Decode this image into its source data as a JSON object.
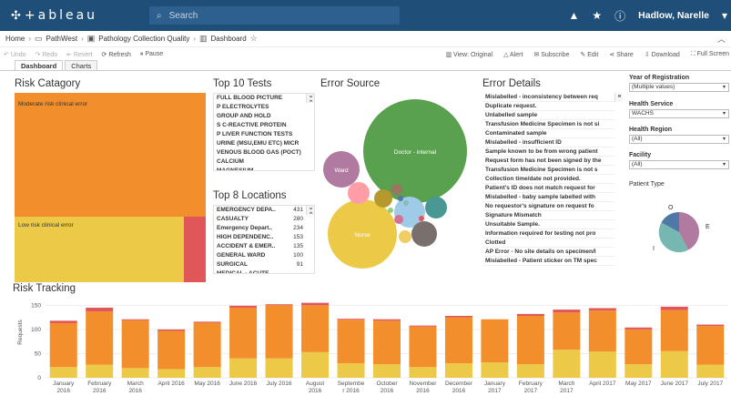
{
  "app": {
    "logo_text": "+ableau",
    "search_placeholder": "Search",
    "user_name": "Hadlow, Narelle"
  },
  "breadcrumb": {
    "items": [
      "Home",
      "PathWest",
      "Pathology Collection Quality",
      "Dashboard"
    ]
  },
  "toolbar": {
    "undo": "Undo",
    "redo": "Redo",
    "revert": "Revert",
    "refresh": "Refresh",
    "pause": "Pause",
    "view": "View: Original",
    "alert": "Alert",
    "subscribe": "Subscribe",
    "edit": "Edit",
    "share": "Share",
    "download": "Download",
    "fullscreen": "Full Screen"
  },
  "tabs": [
    "Dashboard",
    "Charts"
  ],
  "risk_category": {
    "title": "Risk Catagory",
    "blocks": [
      {
        "label": "Moderate risk clinical error",
        "color": "#f28e2b"
      },
      {
        "label": "Low risk clinical error",
        "color": "#edc948"
      },
      {
        "label": "",
        "color": "#e15759"
      }
    ]
  },
  "top_tests": {
    "title": "Top 10 Tests",
    "items": [
      "FULL BLOOD PICTURE",
      "P ELECTROLYTES",
      "GROUP AND HOLD",
      "S C-REACTIVE PROTEIN",
      "P LIVER FUNCTION TESTS",
      "URINE (MSU,EMU ETC) MICR",
      "VENOUS BLOOD GAS (POCT)",
      "CALCIUM",
      "MAGNESIUM"
    ]
  },
  "top_locations": {
    "title": "Top 8 Locations",
    "items": [
      {
        "name": "EMERGENCY DEPA..",
        "count": "431"
      },
      {
        "name": "CASUALTY",
        "count": "280"
      },
      {
        "name": "Emergency Depart..",
        "count": "234"
      },
      {
        "name": "HIGH DEPENDENC..",
        "count": "153"
      },
      {
        "name": "ACCIDENT & EMER..",
        "count": "135"
      },
      {
        "name": "GENERAL WARD",
        "count": "100"
      },
      {
        "name": "SURGICAL",
        "count": "91"
      },
      {
        "name": "MEDICAL - ACUTE",
        "count": ""
      }
    ]
  },
  "error_source": {
    "title": "Error Source",
    "bubble_labels": {
      "doctor": "Doctor - internal",
      "nurse": "Nurse",
      "ward": "Ward"
    }
  },
  "error_details": {
    "title": "Error Details",
    "items": [
      "Mislabelled - inconsistency between req",
      "Duplicate request.",
      "Unlabelled sample",
      "Transfusion Medicine Specimen is not si",
      "Contaminated sample",
      "Mislabelled - insufficient ID",
      "Sample known to be from wrong patient",
      "Request form has not been signed by the",
      "Transfusion Medicine Specimen is not s",
      "Collection time/date not provided.",
      "Patient's ID does not match request for",
      "Mislabelled - baby sample labelled with",
      "No requestor's signature on request fo",
      "Signature Mismatch",
      "Unsuitable Sample.",
      "Information required for testing not pro",
      "Clotted",
      "AP Error - No site details on specimen/I",
      "Mislabelled - Patient sticker on TM spec"
    ]
  },
  "filters": {
    "year": {
      "label": "Year of Registration",
      "value": "(Multiple values)"
    },
    "health_service": {
      "label": "Health Service",
      "value": "WACHS"
    },
    "health_region": {
      "label": "Health Region",
      "value": "(All)"
    },
    "facility": {
      "label": "Facility",
      "value": "(All)"
    },
    "patient_type": {
      "label": "Patient Type",
      "pie_labels": [
        "O",
        "E",
        "I"
      ]
    }
  },
  "risk_tracking": {
    "title": "Risk Tracking",
    "ylabel": "Requests",
    "colors": {
      "low": "#edc948",
      "moderate": "#f28e2b",
      "high": "#e15759"
    }
  },
  "chart_data": {
    "type": "bar",
    "title": "Risk Tracking",
    "xlabel": "",
    "ylabel": "Requests",
    "ylim": [
      0,
      160
    ],
    "yticks": [
      0,
      50,
      100,
      150
    ],
    "categories": [
      [
        "January",
        "2016"
      ],
      [
        "February",
        "2016"
      ],
      [
        "March",
        "2016"
      ],
      [
        "April 2016"
      ],
      [
        "May 2016"
      ],
      [
        "June 2016"
      ],
      [
        "July 2016"
      ],
      [
        "August",
        "2016"
      ],
      [
        "Septembe",
        "r 2016"
      ],
      [
        "October",
        "2016"
      ],
      [
        "November",
        "2016"
      ],
      [
        "December",
        "2016"
      ],
      [
        "January",
        "2017"
      ],
      [
        "February",
        "2017"
      ],
      [
        "March",
        "2017"
      ],
      [
        "April 2017"
      ],
      [
        "May 2017"
      ],
      [
        "June 2017"
      ],
      [
        "July 2017"
      ]
    ],
    "series": [
      {
        "values": [
          22,
          27,
          20,
          18,
          22,
          40,
          40,
          53,
          30,
          28,
          22,
          30,
          32,
          28,
          58,
          54,
          28,
          55,
          27
        ]
      },
      {
        "values": [
          91,
          110,
          99,
          79,
          92,
          105,
          110,
          97,
          90,
          90,
          84,
          95,
          89,
          100,
          77,
          85,
          72,
          85,
          80
        ]
      },
      {
        "values": [
          5,
          8,
          2,
          3,
          2,
          4,
          2,
          5,
          2,
          3,
          2,
          3,
          0,
          4,
          6,
          5,
          4,
          7,
          3
        ]
      }
    ]
  }
}
